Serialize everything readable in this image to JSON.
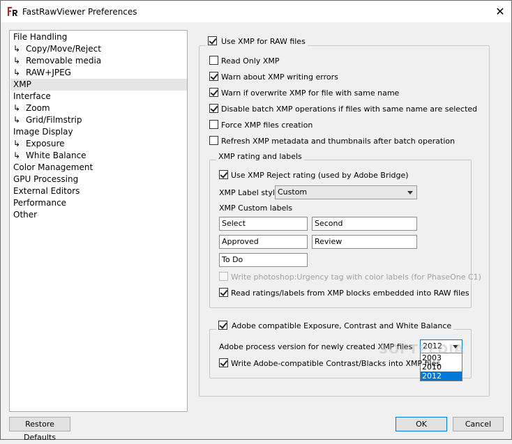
{
  "window": {
    "title": "FastRawViewer Preferences",
    "close_glyph": "✕"
  },
  "nav": {
    "items": [
      {
        "label": "File Handling",
        "sub": false
      },
      {
        "label": "Copy/Move/Reject",
        "sub": true
      },
      {
        "label": "Removable media",
        "sub": true
      },
      {
        "label": "RAW+JPEG",
        "sub": true
      },
      {
        "label": "XMP",
        "sub": false,
        "selected": true
      },
      {
        "label": "Interface",
        "sub": false
      },
      {
        "label": "Zoom",
        "sub": true
      },
      {
        "label": "Grid/Filmstrip",
        "sub": true
      },
      {
        "label": "Image Display",
        "sub": false
      },
      {
        "label": "Exposure",
        "sub": true
      },
      {
        "label": "White Balance",
        "sub": true
      },
      {
        "label": "Color Management",
        "sub": false
      },
      {
        "label": "GPU Processing",
        "sub": false
      },
      {
        "label": "External Editors",
        "sub": false
      },
      {
        "label": "Performance",
        "sub": false
      },
      {
        "label": "Other",
        "sub": false
      }
    ],
    "sub_arrow": "↳"
  },
  "xmp": {
    "use_xmp_label": "Use XMP for RAW files",
    "read_only_label": "Read Only XMP",
    "warn_errors_label": "Warn about XMP writing errors",
    "warn_overwrite_label": "Warn if overwrite XMP for file with same name",
    "disable_batch_label": "Disable batch XMP operations if files with same name are selected",
    "force_creation_label": "Force XMP files creation",
    "refresh_label": "Refresh XMP metadata and thumbnails after batch operation"
  },
  "rating_group": {
    "title": "XMP rating and labels",
    "use_reject_label": "Use XMP Reject rating (used by Adobe Bridge)",
    "label_style_label": "XMP Label style",
    "label_style_value": "Custom",
    "custom_labels_title": "XMP Custom labels",
    "custom_labels": [
      "Select",
      "Second",
      "Approved",
      "Review",
      "To Do"
    ],
    "urgency_label": "Write photoshop:Urgency tag with color labels (for PhaseOne C1)",
    "read_embedded_label": "Read ratings/labels from XMP blocks embedded into RAW files"
  },
  "adobe_group": {
    "title": "Adobe compatible Exposure, Contrast and White Balance",
    "process_version_label": "Adobe process version for newly created XMP files",
    "process_version_value": "2012",
    "process_version_options": [
      "2003",
      "2010",
      "2012"
    ],
    "write_contrast_label": "Write Adobe-compatible Contrast/Blacks into XMP files"
  },
  "buttons": {
    "restore_defaults": "Restore Defaults",
    "ok": "OK",
    "cancel": "Cancel"
  },
  "watermark": "SOFTPEDIA"
}
